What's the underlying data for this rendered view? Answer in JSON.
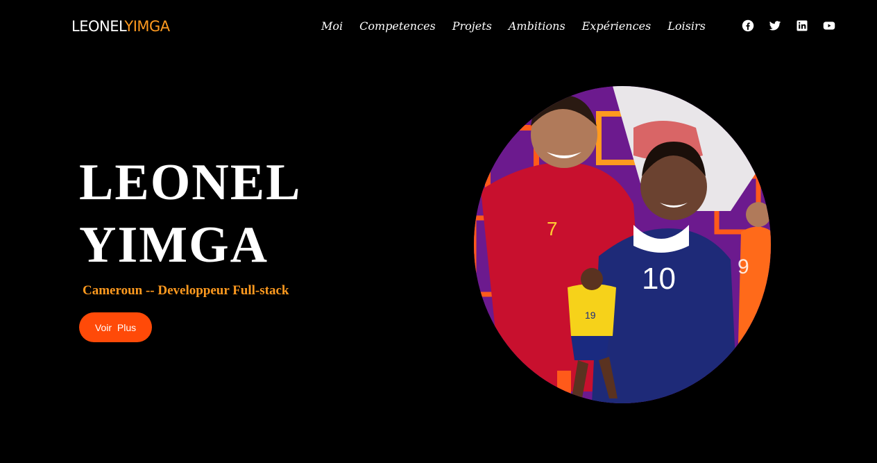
{
  "header": {
    "logo_first": "LEONEL",
    "logo_last": "YIMGA",
    "nav": [
      {
        "label": "Moi"
      },
      {
        "label": "Competences"
      },
      {
        "label": "Projets"
      },
      {
        "label": "Ambitions"
      },
      {
        "label": "Expériences"
      },
      {
        "label": "Loisirs"
      }
    ],
    "social": [
      {
        "icon": "facebook-icon"
      },
      {
        "icon": "twitter-icon"
      },
      {
        "icon": "linkedin-icon"
      },
      {
        "icon": "youtube-icon"
      }
    ]
  },
  "hero": {
    "title_line1": "LEONEL",
    "title_line2": "YIMGA",
    "subtitle": "Cameroun -- Developpeur Full-stack",
    "button_label": "Voir Plus",
    "image": {
      "description_icon": "football-players-image",
      "jersey_number_left": "7",
      "jersey_number_center": "10",
      "jersey_number_small": "19",
      "jersey_number_right": "9"
    }
  },
  "colors": {
    "background": "#000000",
    "accent_orange": "#ff9a1f",
    "button": "#ff4a08"
  }
}
